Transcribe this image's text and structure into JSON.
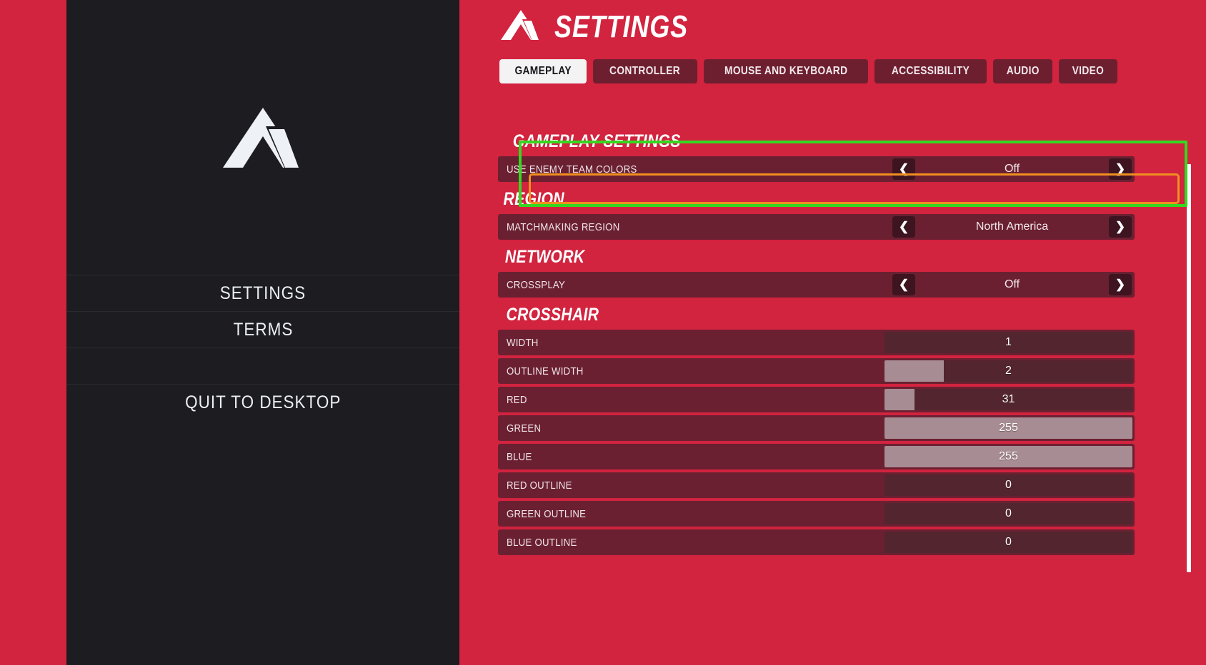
{
  "sidebar": {
    "logo_icon": "apex-chevron-logo-icon",
    "items": [
      {
        "label": "SETTINGS",
        "name": "sidebar-item-settings"
      },
      {
        "label": "TERMS",
        "name": "sidebar-item-terms"
      },
      {
        "label": "",
        "name": "sidebar-item-blank"
      },
      {
        "label": "QUIT TO DESKTOP",
        "name": "sidebar-item-quit-to-desktop"
      }
    ]
  },
  "header": {
    "title": "SETTINGS",
    "logo_icon": "apex-chevron-logo-icon"
  },
  "tabs": [
    {
      "label": "GAMEPLAY",
      "active": true
    },
    {
      "label": "CONTROLLER",
      "active": false
    },
    {
      "label": "MOUSE AND KEYBOARD",
      "active": false
    },
    {
      "label": "ACCESSIBILITY",
      "active": false
    },
    {
      "label": "AUDIO",
      "active": false
    },
    {
      "label": "VIDEO",
      "active": false
    }
  ],
  "groups": [
    {
      "title": "GAMEPLAY SETTINGS",
      "rows": [
        {
          "label": "USE ENEMY TEAM COLORS",
          "type": "stepper",
          "value": "Off",
          "left_arrow": "chevron-left-icon",
          "right_arrow": "chevron-right-icon",
          "focused": true
        }
      ]
    },
    {
      "title": "REGION",
      "rows": [
        {
          "label": "MATCHMAKING REGION",
          "type": "stepper",
          "value": "North America",
          "left_arrow": "chevron-left-icon",
          "right_arrow": "chevron-right-icon",
          "focused": false
        }
      ]
    },
    {
      "title": "NETWORK",
      "rows": [
        {
          "label": "CROSSPLAY",
          "type": "stepper",
          "value": "Off",
          "left_arrow": "chevron-left-icon",
          "right_arrow": "chevron-right-icon",
          "focused": false
        }
      ]
    },
    {
      "title": "CROSSHAIR",
      "rows": [
        {
          "label": "WIDTH",
          "type": "slider",
          "value": "1",
          "fill_percent": 0
        },
        {
          "label": "OUTLINE WIDTH",
          "type": "slider",
          "value": "2",
          "fill_percent": 24
        },
        {
          "label": "RED",
          "type": "slider",
          "value": "31",
          "fill_percent": 12
        },
        {
          "label": "GREEN",
          "type": "slider",
          "value": "255",
          "fill_percent": 100
        },
        {
          "label": "BLUE",
          "type": "slider",
          "value": "255",
          "fill_percent": 100
        },
        {
          "label": "RED OUTLINE",
          "type": "slider",
          "value": "0",
          "fill_percent": 0
        },
        {
          "label": "GREEN OUTLINE",
          "type": "slider",
          "value": "0",
          "fill_percent": 0
        },
        {
          "label": "BLUE OUTLINE",
          "type": "slider",
          "value": "0",
          "fill_percent": 0
        }
      ]
    }
  ],
  "scrollbar": {
    "thumb_position_percent": 0
  },
  "annotations": {
    "group_highlight_color": "#35d820",
    "row_focus_color": "#f09020"
  },
  "colors": {
    "background_red": "#d2233f",
    "sidebar_dark": "#1c1c21",
    "row_maroon": "#6b2031",
    "slider_track": "#53252f",
    "slider_fill": "#a88c93",
    "arrow_button": "#3d1420",
    "tab_inactive": "#6e1f2f",
    "tab_active": "#f3f3f3"
  }
}
